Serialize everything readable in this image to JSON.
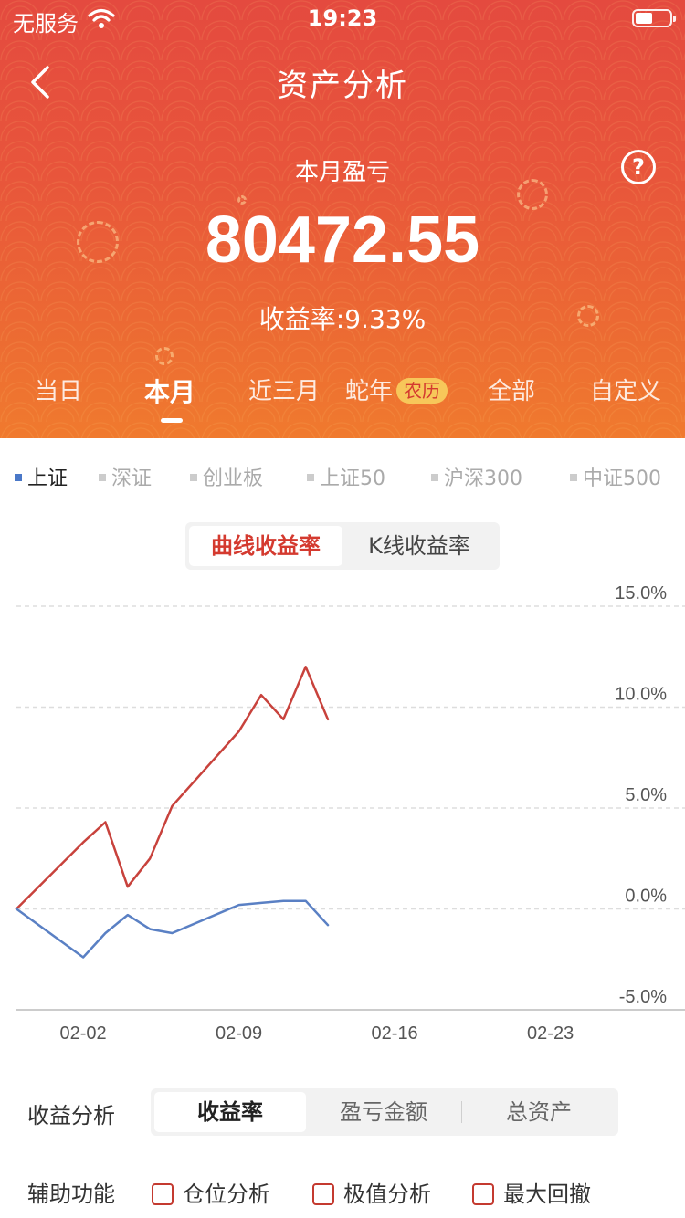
{
  "status_bar": {
    "carrier": "无服务",
    "time": "19:23"
  },
  "nav": {
    "title": "资产分析"
  },
  "summary": {
    "label": "本月盈亏",
    "value": "80472.55",
    "rate_text": "收益率:9.33%"
  },
  "period_tabs": [
    {
      "label": "当日"
    },
    {
      "label": "本月",
      "active": true
    },
    {
      "label": "近三月"
    },
    {
      "label": "蛇年",
      "badge": "农历"
    },
    {
      "label": "全部"
    },
    {
      "label": "自定义"
    }
  ],
  "index_legend": [
    {
      "label": "上证",
      "active": true
    },
    {
      "label": "深证"
    },
    {
      "label": "创业板"
    },
    {
      "label": "上证50"
    },
    {
      "label": "沪深300"
    },
    {
      "label": "中证500"
    }
  ],
  "chart_switch": {
    "active": "曲线收益率",
    "inactive": "K线收益率"
  },
  "colors": {
    "portfolio": "#c8423c",
    "index": "#5a80c4",
    "brand_red": "#e44a3f"
  },
  "chart_data": {
    "type": "line",
    "y_tick_labels": [
      "15.0%",
      "10.0%",
      "5.0%",
      "0.0%",
      "-5.0%"
    ],
    "y_ticks": [
      15,
      10,
      5,
      0,
      -5
    ],
    "ylim": [
      -5,
      15
    ],
    "x_tick_labels": [
      "02-02",
      "02-09",
      "02-16",
      "02-23"
    ],
    "x_ticks": [
      3,
      10,
      17,
      24
    ],
    "xlim": [
      0,
      30
    ],
    "grid": true,
    "series": [
      {
        "color": "#c8423c",
        "x": [
          0,
          3,
          4,
          5,
          6,
          7,
          10,
          11,
          12,
          13,
          14
        ],
        "y": [
          0.0,
          3.3,
          4.3,
          1.1,
          2.5,
          5.1,
          8.8,
          10.6,
          9.4,
          12.0,
          9.4
        ]
      },
      {
        "color": "#5a80c4",
        "x": [
          0,
          3,
          4,
          5,
          6,
          7,
          10,
          11,
          12,
          13,
          14
        ],
        "y": [
          0.0,
          -2.4,
          -1.2,
          -0.3,
          -1.0,
          -1.2,
          0.2,
          0.3,
          0.4,
          0.4,
          -0.8
        ]
      }
    ]
  },
  "analysis": {
    "label": "收益分析",
    "options": [
      {
        "label": "收益率",
        "active": true
      },
      {
        "label": "盈亏金额"
      },
      {
        "label": "总资产"
      }
    ]
  },
  "aux": {
    "label": "辅助功能",
    "options": [
      {
        "label": "仓位分析"
      },
      {
        "label": "极值分析"
      },
      {
        "label": "最大回撤"
      }
    ]
  }
}
